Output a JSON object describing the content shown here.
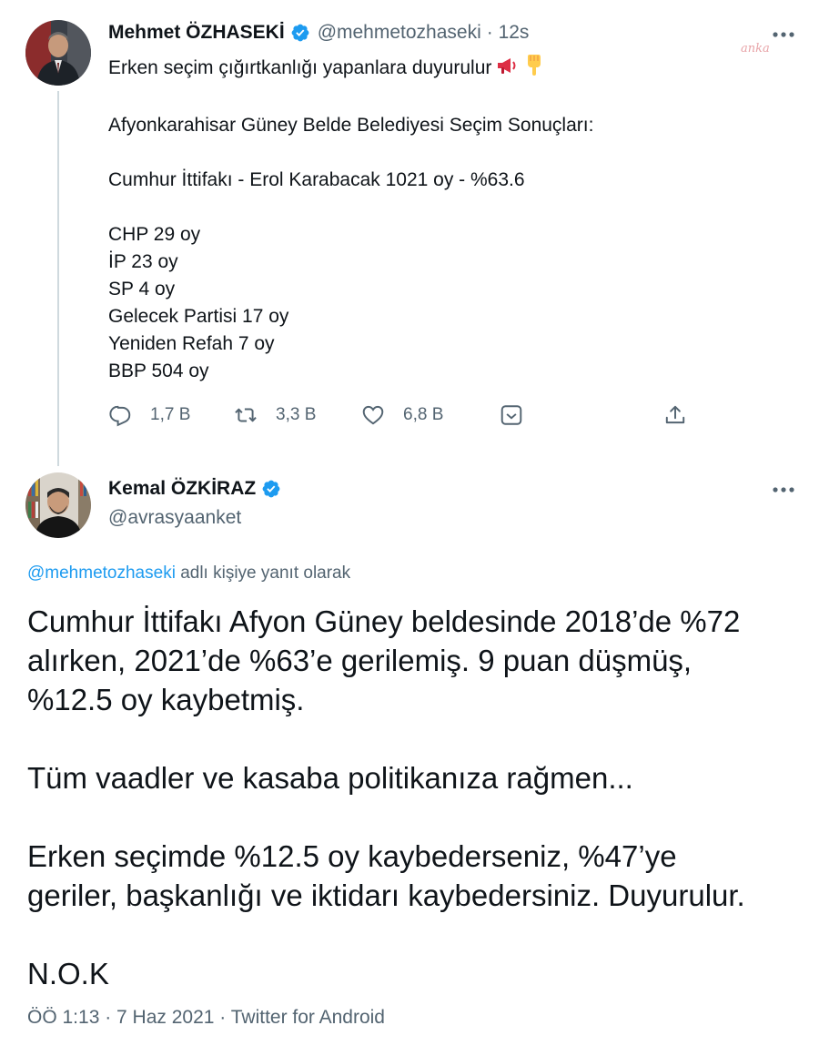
{
  "tweet1": {
    "author_name": "Mehmet ÖZHASEKİ",
    "handle": "@mehmetozhaseki",
    "time": "· 12s",
    "watermark": "anka",
    "text_line1": "Erken seçim çığırtkanlığı yapanlara duyurulur",
    "emojis": [
      "loudspeaker-emoji",
      "pointing-down-emoji"
    ],
    "lines": [
      "Afyonkarahisar Güney Belde Belediyesi Seçim Sonuçları:",
      "",
      "Cumhur İttifakı - Erol Karabacak 1021 oy - %63.6",
      "",
      "CHP 29 oy",
      "İP 23 oy",
      "SP 4 oy",
      "Gelecek Partisi 17 oy",
      "Yeniden Refah 7 oy",
      "BBP 504 oy"
    ],
    "actions": {
      "reply_count": "1,7 B",
      "retweet_count": "3,3 B",
      "like_count": "6,8 B"
    }
  },
  "tweet2": {
    "author_name": "Kemal ÖZKİRAZ",
    "handle": "@avrasyaanket",
    "reply_to_handle": "@mehmetozhaseki",
    "reply_to_suffix": "adlı kişiye yanıt olarak",
    "paragraphs": [
      [
        "Cumhur İttifakı Afyon Güney beldesinde 2018’de %72",
        "alırken, 2021’de %63’e gerilemiş. 9 puan düşmüş,",
        "%12.5 oy kaybetmiş."
      ],
      [
        "Tüm vaadler ve kasaba politikanıza rağmen..."
      ],
      [
        "Erken seçimde %12.5  oy kaybederseniz, %47’ye",
        "geriler, başkanlığı ve iktidarı kaybedersiniz. Duyurulur."
      ],
      [
        "N.O.K"
      ]
    ],
    "meta": "ÖÖ 1:13 · 7 Haz 2021 · Twitter for Android"
  },
  "colors": {
    "accent": "#1d9bf0",
    "muted": "#536471",
    "text": "#0f1419",
    "thread_line": "#cfd9de"
  }
}
